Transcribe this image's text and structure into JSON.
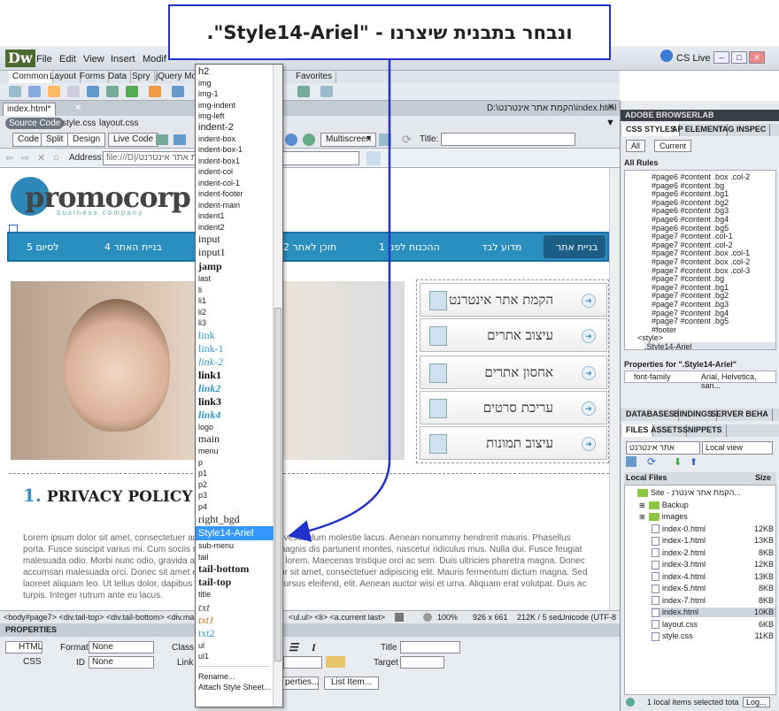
{
  "callout": {
    "text": "ונבחר בתבנית שיצרנו - \"Style14-Ariel\"."
  },
  "app": {
    "logo": "Dw",
    "cs_live": "CS Live"
  },
  "menubar": [
    "File",
    "Edit",
    "View",
    "Insert",
    "Modif"
  ],
  "insert_tabs": [
    "Common",
    "Layout",
    "Forms",
    "Data",
    "Spry",
    "jQuery Mobil",
    "Favorites"
  ],
  "document": {
    "tab": "index.html*",
    "path": "D:\\הקמת אתר אינטרנט\\index.html",
    "related": [
      "Source Code",
      "style.css",
      "layout.css"
    ],
    "view_buttons": [
      "Code",
      "Split",
      "Design",
      "Live Code"
    ],
    "multiscreen": "Multiscreen",
    "title_label": "Title:",
    "address_label": "Address:",
    "address_value": "file:///D|/הקמת אתר אינטרנט/"
  },
  "page": {
    "logo_main": "promocorp",
    "logo_sub": "business company",
    "nav": [
      "בניית אתר",
      "מדוע לבד",
      "1 ההכנות לפני",
      "2 תוכן לאתר",
      "4 בניית האתר",
      "5 לסיום"
    ],
    "services": [
      "הקמת אתר אינטרנט",
      "עיצוב אתרים",
      "אחסון אתרים",
      "עריכת סרטים",
      "עיצוב תמונות"
    ],
    "policy_num": "1.",
    "policy_title": "PRIVACY POLICY",
    "lorem": "Lorem ipsum dolor sit amet, consectetuer adipiscing elit. Praesent vestibulum molestie lacus. Aenean nonummy hendrerit mauris. Phasellus porta. Fusce suscipit varius mi. Cum sociis natoque penatibus et magnis dis parturient montes, nascetur ridiculus mus. Nulla dui. Fusce feugiat malesuada odio. Morbi nunc odio, gravida at, cursus nec, luctus a, lorem. Maecenas tristique orci ac sem. Duis ultricies pharetra magna. Donec accumsan malesuada orci. Donec sit amet eros. Lorem ipsum dolor sit amet, consectetuer adipiscing elit. Mauris fermentum dictum magna. Sed laoreet aliquam leo. Ut tellus dolor, dapibus eget, elementum vel, cursus eleifend, elit. Aenean auctor wisi et urna. Aliquam erat volutpat. Duis ac turpis. Integer rutrum ante eu lacus."
  },
  "tagbar": {
    "path": "<body#page7> <div.tail-top> <div.tail-bottom> <div.main>",
    "path2": "<ul.ul> <li> <a.current last>",
    "zoom": "100%",
    "size": "926 x 661",
    "weight": "212K / 5 sec",
    "encoding": "Unicode (UTF-8"
  },
  "properties": {
    "header": "PROPERTIES",
    "html_btn": "HTML",
    "css_btn": "CSS",
    "format_label": "Format",
    "format_value": "None",
    "class_label": "Class",
    "id_label": "ID",
    "id_value": "None",
    "link_label": "Link",
    "title_label": "Title",
    "target_label": "Target",
    "page_props": "perties...",
    "list_item": "List Item..."
  },
  "dropdown": [
    "h2",
    "img",
    "img-1",
    "img-indent",
    "img-left",
    "indent-2",
    "indent-box",
    "indent-box-1",
    "indent-box1",
    "indent-col",
    "indent-col-1",
    "indent-footer",
    "indent-main",
    "indent1",
    "indent2",
    "input",
    "input1",
    "jamp",
    "last",
    "li",
    "li1",
    "li2",
    "li3",
    "link",
    "link-1",
    "link-2",
    "link1",
    "link2",
    "link3",
    "link4",
    "logo",
    "main",
    "menu",
    "p",
    "p1",
    "p2",
    "p3",
    "p4",
    "right_bgd",
    "Style14-Ariel",
    "sub-menu",
    "tail",
    "tail-bottom",
    "tail-top",
    "title",
    "txt",
    "txt1",
    "txt2",
    "ul",
    "ul1",
    "",
    "Rename...",
    "Attach Style Sheet..."
  ],
  "right_panel": {
    "browserlab": "ADOBE BROWSERLAB",
    "css_tabs": [
      "CSS STYLES",
      "AP ELEMENT",
      "TAG INSPEC"
    ],
    "all_btn": "All",
    "current_btn": "Current",
    "all_rules": "All Rules",
    "rules": [
      "#page6 #content .box .col-2",
      "#page6 #content .bg",
      "#page6 #content .bg1",
      "#page6 #content .bg2",
      "#page6 #content .bg3",
      "#page6 #content .bg4",
      "#page6 #content .bg5",
      "#page7 #content .col-1",
      "#page7 #content .col-2",
      "#page7 #content .box .col-1",
      "#page7 #content .box .col-2",
      "#page7 #content .box .col-3",
      "#page7 #content .bg",
      "#page7 #content .bg1",
      "#page7 #content .bg2",
      "#page7 #content .bg3",
      "#page7 #content .bg4",
      "#page7 #content .bg5",
      "#footer"
    ],
    "style_tag": "<style>",
    "style_rule": ".Style14-Ariel",
    "props_for": "Properties for \".Style14-Ariel\"",
    "prop_name": "font-family",
    "prop_value": "Arial, Helvetica, san...",
    "db_tabs": [
      "DATABASES",
      "BINDINGS",
      "SERVER BEHA"
    ],
    "files_tabs": [
      "FILES",
      "ASSETS",
      "SNIPPETS"
    ],
    "site_select": "אתר אינטרנט",
    "view_select": "Local view",
    "local_files": "Local Files",
    "size_col": "Size",
    "site_root": "Site - הקמת אתר אינטרנ...",
    "folders": [
      "Backup",
      "images"
    ],
    "files": [
      {
        "name": "index-0.html",
        "size": "12KB"
      },
      {
        "name": "index-1.html",
        "size": "13KB"
      },
      {
        "name": "index-2.html",
        "size": "8KB"
      },
      {
        "name": "index-3.html",
        "size": "12KB"
      },
      {
        "name": "index-4.html",
        "size": "13KB"
      },
      {
        "name": "index-5.html",
        "size": "8KB"
      },
      {
        "name": "index-7.html",
        "size": "8KB"
      },
      {
        "name": "index.html",
        "size": "10KB"
      },
      {
        "name": "layout.css",
        "size": "6KB"
      },
      {
        "name": "style.css",
        "size": "11KB"
      }
    ],
    "status": "1 local items selected tota",
    "log_btn": "Log..."
  },
  "colors": {
    "accent": "#3399ff",
    "nav": "#2a8fbf",
    "arrow": "#2233cc"
  }
}
